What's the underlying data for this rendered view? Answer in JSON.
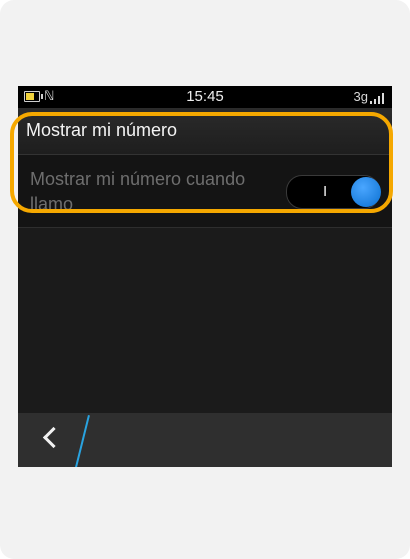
{
  "status_bar": {
    "battery_icon": "battery-charging-icon",
    "nfc_icon": "nfc-icon",
    "nfc_glyph": "ℕ",
    "time": "15:45",
    "network": "3g",
    "signal_icon": "signal-bars-icon"
  },
  "header": {
    "title": "Mostrar mi número"
  },
  "setting": {
    "label": "Mostrar mi número cuando llamo",
    "toggle_on_text": "I",
    "toggle_state": "on"
  },
  "bottom_bar": {
    "back_icon": "chevron-left-icon"
  },
  "colors": {
    "highlight": "#f5a800",
    "toggle_knob": "#1a86e8",
    "divider_accent": "#29a3e0"
  }
}
